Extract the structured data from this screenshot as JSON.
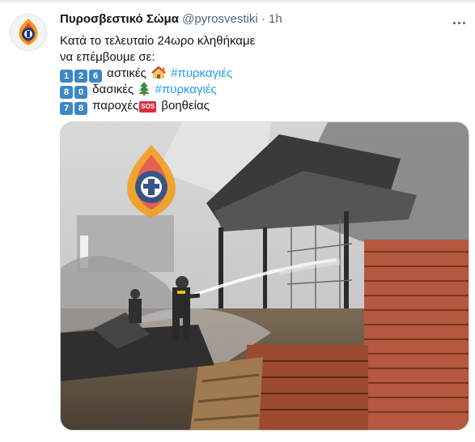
{
  "tweet": {
    "author_name": "Πυροσβεστικό Σώμα",
    "author_handle": "@pyrosvestiki",
    "separator": "·",
    "time": "1h",
    "line1": "Κατά το τελευταίο 24ωρο κληθήκαμε",
    "line2": "να επέμβουμε σε:",
    "stats": [
      {
        "digits": [
          "1",
          "2",
          "6"
        ],
        "label": "αστικές",
        "icon": "house-fire-emoji",
        "hashtag": "#πυρκαγιές"
      },
      {
        "digits": [
          "8",
          "0"
        ],
        "label": "δασικές",
        "icon": "evergreen-tree-emoji",
        "hashtag": "#πυρκαγιές"
      },
      {
        "digits": [
          "7",
          "8"
        ],
        "label": "παροχές",
        "icon": "sos-emoji",
        "sos_text": "SOS",
        "label2": "βοηθείας"
      }
    ]
  },
  "media": {
    "alt_subject": "firefighter-spraying-water-on-burning-warehouse",
    "watermark": "fire-service-emblem"
  },
  "colors": {
    "link": "#1d9bf0",
    "secondary_text": "#536471",
    "keycap": "#3b88c3",
    "sos": "#dd2e44"
  }
}
